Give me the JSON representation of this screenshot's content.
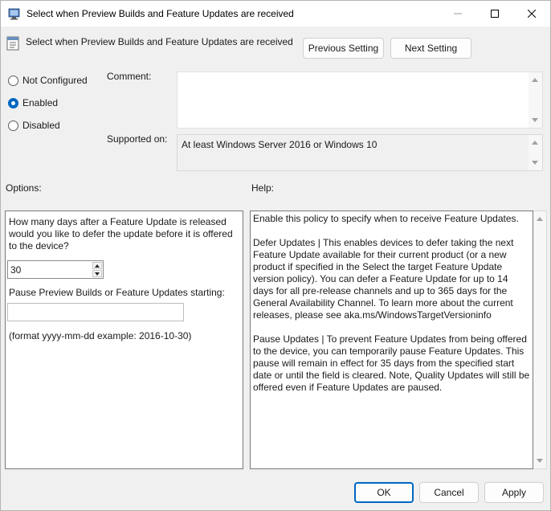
{
  "window": {
    "title": "Select when Preview Builds and Feature Updates are received",
    "icon": "policy-editor-icon"
  },
  "header": {
    "title": "Select when Preview Builds and Feature Updates are received",
    "prev_label": "Previous Setting",
    "next_label": "Next Setting"
  },
  "state": {
    "options": [
      {
        "label": "Not Configured",
        "checked": false
      },
      {
        "label": "Enabled",
        "checked": true
      },
      {
        "label": "Disabled",
        "checked": false
      }
    ]
  },
  "comment": {
    "label": "Comment:",
    "value": ""
  },
  "supported": {
    "label": "Supported on:",
    "value": "At least Windows Server 2016 or Windows 10"
  },
  "options_panel": {
    "heading": "Options:",
    "question": "How many days after a Feature Update is released would you like to defer the update before it is offered to the device?",
    "defer_days": "30",
    "pause_label": "Pause Preview Builds or Feature Updates starting:",
    "pause_value": "",
    "format_hint": "(format yyyy-mm-dd example: 2016-10-30)"
  },
  "help_panel": {
    "heading": "Help:",
    "paragraphs": [
      "Enable this policy to specify when to receive Feature Updates.",
      "Defer Updates | This enables devices to defer taking the next Feature Update available for their current product (or a new product if specified in the Select the target Feature Update version policy). You can defer a Feature Update for up to 14 days for all pre-release channels and up to 365 days for the General Availability Channel. To learn more about the current releases, please see aka.ms/WindowsTargetVersioninfo",
      "Pause Updates | To prevent Feature Updates from being offered to the device, you can temporarily pause Feature Updates. This pause will remain in effect for 35 days from the specified start date or until the field is cleared. Note, Quality Updates will still be offered even if Feature Updates are paused."
    ]
  },
  "footer": {
    "ok_label": "OK",
    "cancel_label": "Cancel",
    "apply_label": "Apply"
  },
  "colors": {
    "accent": "#0067c0",
    "window_bg": "#f0f0f0"
  }
}
